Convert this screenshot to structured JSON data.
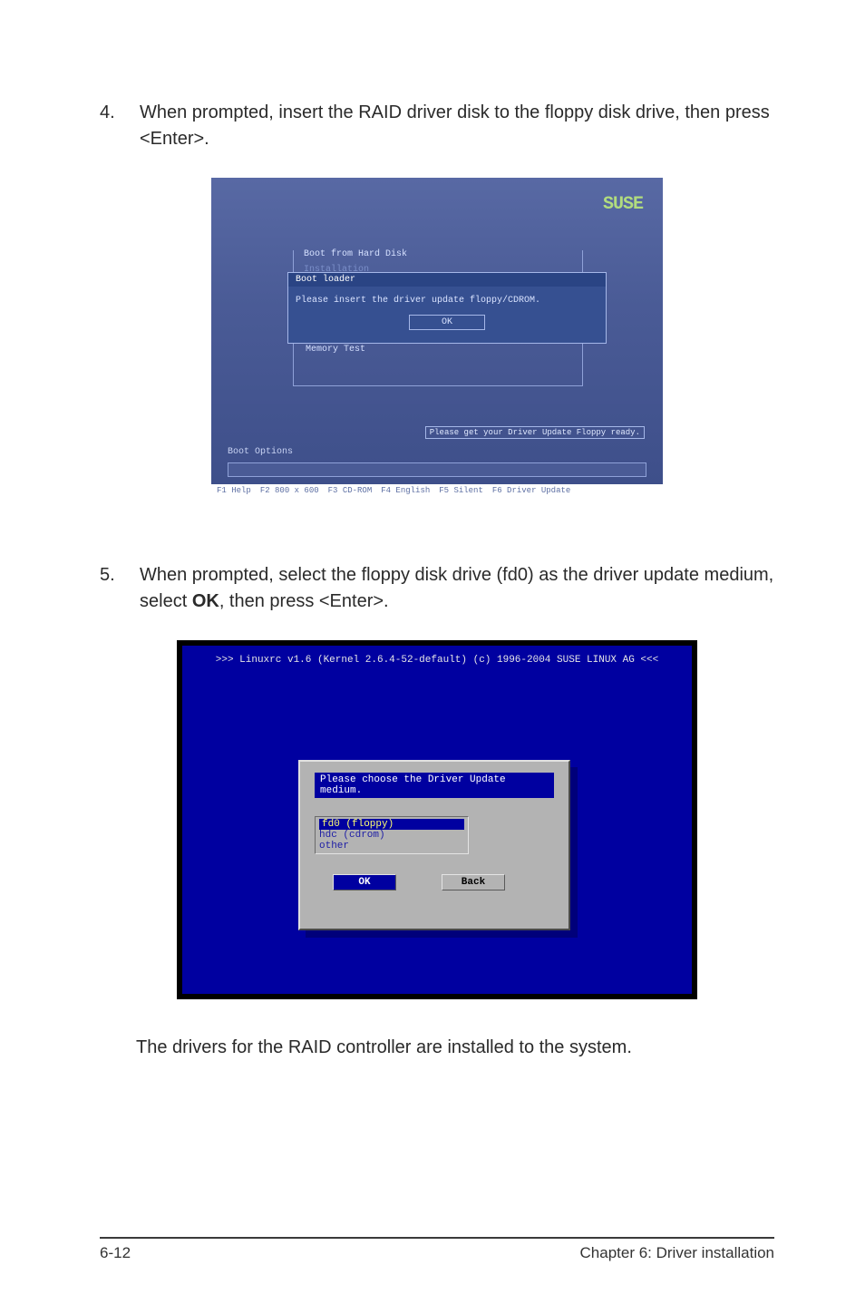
{
  "steps": {
    "s4": {
      "num": "4.",
      "text_a": "When prompted, insert the RAID driver disk to the floppy disk drive, then press <Enter>."
    },
    "s5": {
      "num": "5.",
      "text_before": "When prompted, select the floppy disk drive (fd0) as the driver update medium, select ",
      "ok": "OK",
      "text_after": ", then press <Enter>."
    }
  },
  "shot1": {
    "logo": "SUSE",
    "menu": {
      "item0": "Boot from Hard Disk",
      "item1": "Installation"
    },
    "modal_title": "Boot loader",
    "modal_text": "Please insert the driver update floppy/CDROM.",
    "ok_label": "OK",
    "memtest": "Memory Test",
    "floppy_ready": "Please get your Driver Update Floppy ready.",
    "boot_options_label": "Boot Options",
    "fkeys": {
      "f1": "F1 Help",
      "f2": "F2 800 x 600",
      "f3": "F3 CD-ROM",
      "f4": "F4 English",
      "f5": "F5 Silent",
      "f6": "F6 Driver Update"
    }
  },
  "shot2": {
    "title": ">>> Linuxrc v1.6 (Kernel 2.6.4-52-default) (c) 1996-2004 SUSE LINUX AG <<<",
    "dlg_title": "Please choose the Driver Update medium.",
    "options": {
      "o0": "fd0 (floppy)",
      "o1": "hdc (cdrom)",
      "o2": "other"
    },
    "btn_ok": "OK",
    "btn_back": "Back"
  },
  "final_line": "The drivers for the RAID controller are installed to the system.",
  "footer": {
    "left": "6-12",
    "right": "Chapter 6: Driver installation"
  }
}
